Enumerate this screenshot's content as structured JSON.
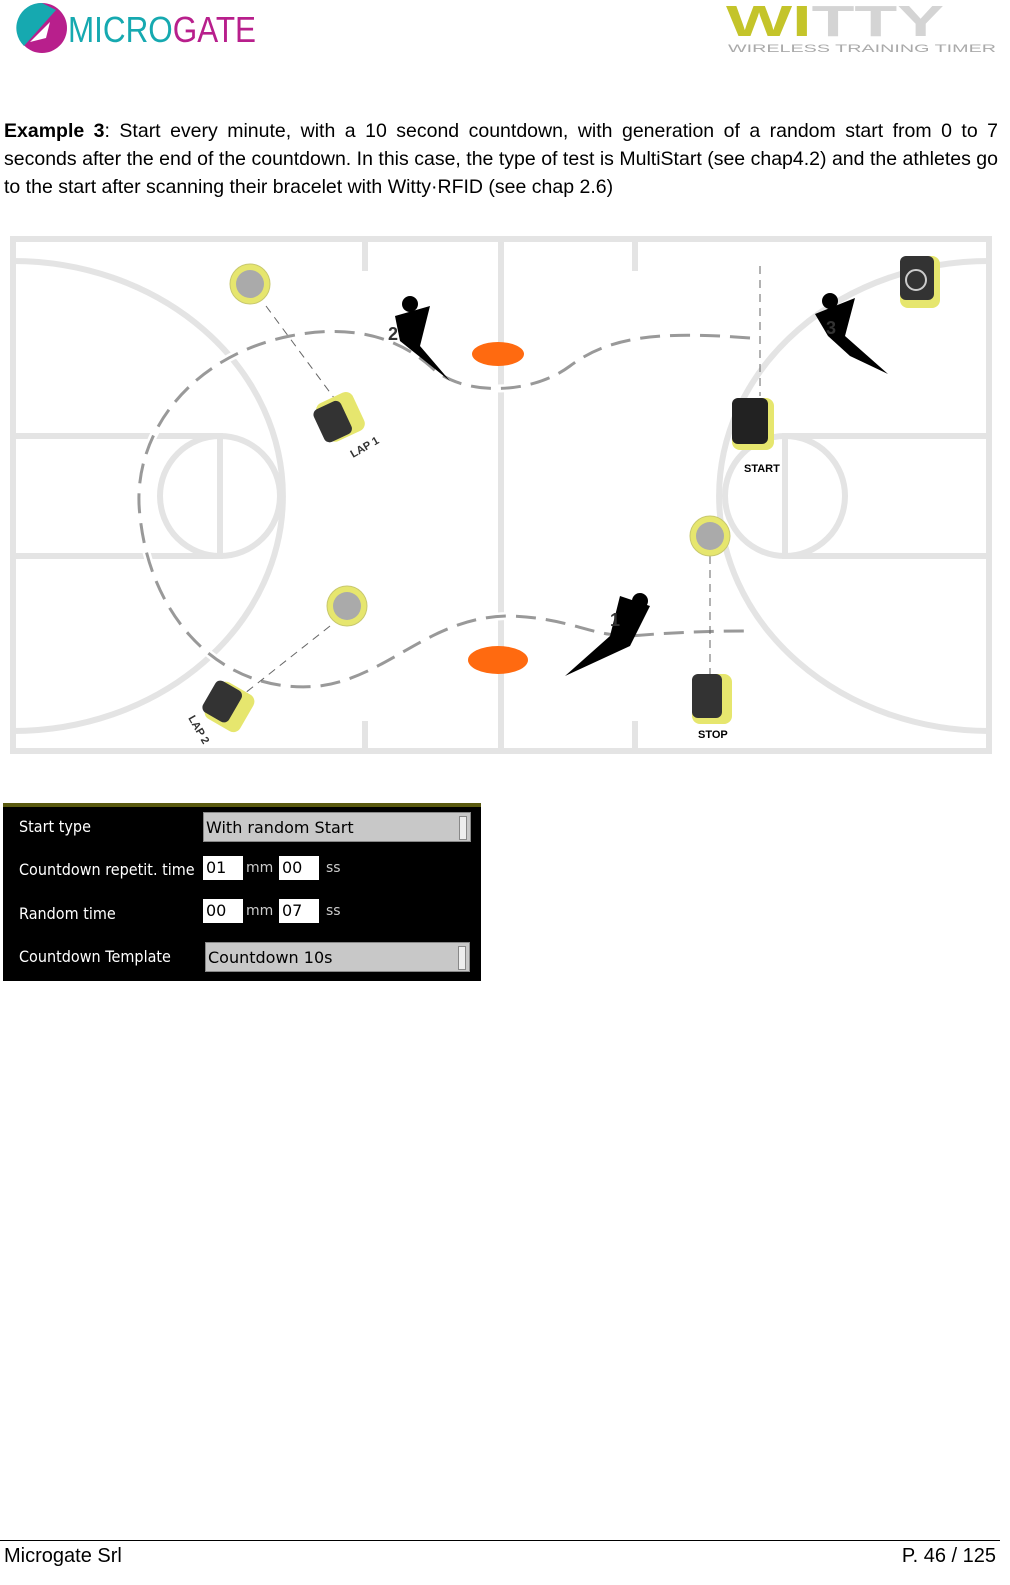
{
  "header": {
    "left_logo": "MICROGATE",
    "right_logo": "WITTY",
    "right_logo_tagline": "WIRELESS TRAINING TIMER"
  },
  "intro": {
    "heading": "Example 3",
    "text": ": Start every minute, with a 10 second countdown, with generation of a random start from 0 to 7 seconds after the end of the countdown. In this case, the type of test is MultiStart (see chap4.2) and the athletes go to the start after scanning their bracelet with Witty·RFID (see chap 2.6)"
  },
  "diagram": {
    "labels": {
      "lap1": "LAP 1",
      "lap2": "LAP 2",
      "start": "START",
      "stop": "STOP"
    },
    "runners": [
      "1",
      "2",
      "3"
    ],
    "colors": {
      "photocell": "#e6e66e",
      "cone": "#ff6a10",
      "court": "#e4e4e4"
    }
  },
  "settings": {
    "start_type": {
      "label": "Start type",
      "value": "With random Start"
    },
    "countdown_repetition": {
      "label": "Countdown repetit. time",
      "mm": "01",
      "ss": "00"
    },
    "random_time": {
      "label": "Random time",
      "mm": "00",
      "ss": "07"
    },
    "countdown_template": {
      "label": "Countdown Template",
      "value": "Countdown 10s"
    },
    "unit_mm": "mm",
    "unit_ss": "ss"
  },
  "footer": {
    "company": "Microgate Srl",
    "page": "P. 46 / 125"
  }
}
